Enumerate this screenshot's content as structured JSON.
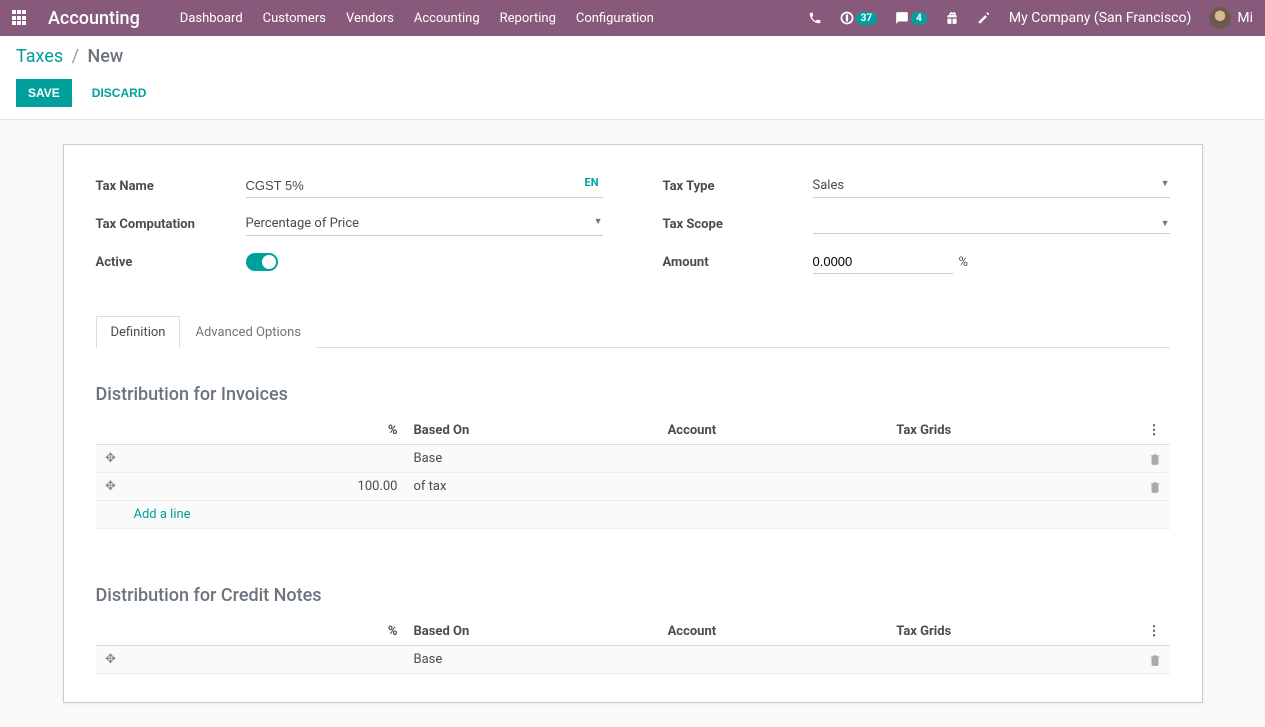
{
  "navbar": {
    "brand": "Accounting",
    "menu": [
      "Dashboard",
      "Customers",
      "Vendors",
      "Accounting",
      "Reporting",
      "Configuration"
    ],
    "activity_badge": "37",
    "messaging_badge": "4",
    "company": "My Company (San Francisco)",
    "user": "Mi"
  },
  "breadcrumb": {
    "parent": "Taxes",
    "current": "New"
  },
  "buttons": {
    "save": "Save",
    "discard": "Discard"
  },
  "form": {
    "tax_name_label": "Tax Name",
    "tax_name_value": "CGST 5%",
    "lang": "EN",
    "tax_computation_label": "Tax Computation",
    "tax_computation_value": "Percentage of Price",
    "active_label": "Active",
    "tax_type_label": "Tax Type",
    "tax_type_value": "Sales",
    "tax_scope_label": "Tax Scope",
    "tax_scope_value": "",
    "amount_label": "Amount",
    "amount_value": "0.0000",
    "amount_suffix": "%"
  },
  "tabs": {
    "definition": "Definition",
    "advanced": "Advanced Options"
  },
  "sections": {
    "invoices_title": "Distribution for Invoices",
    "credit_notes_title": "Distribution for Credit Notes",
    "headers": {
      "percent": "%",
      "based_on": "Based On",
      "account": "Account",
      "tax_grids": "Tax Grids"
    },
    "invoice_rows": [
      {
        "percent": "",
        "based_on": "Base"
      },
      {
        "percent": "100.00",
        "based_on": "of tax"
      }
    ],
    "credit_rows": [
      {
        "percent": "",
        "based_on": "Base"
      }
    ],
    "add_line": "Add a line"
  }
}
